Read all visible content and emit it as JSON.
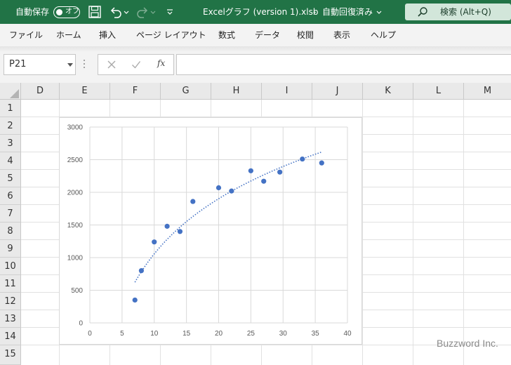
{
  "titlebar": {
    "autosave_label": "自動保存",
    "autosave_toggle": "オフ",
    "filename": "Excelグラフ (version 1).xlsb",
    "separator": "-",
    "status": "自動回復済み",
    "search_label": "検索 (Alt+Q)",
    "background_color": "#217346"
  },
  "menu": {
    "items": [
      "ファイル",
      "ホーム",
      "挿入",
      "ページ レイアウト",
      "数式",
      "データ",
      "校閲",
      "表示",
      "ヘルプ"
    ]
  },
  "formula_bar": {
    "name_box": "P21",
    "fx_label": "fx",
    "value": ""
  },
  "sheet": {
    "columns": [
      "D",
      "E",
      "F",
      "G",
      "H",
      "I",
      "J",
      "K",
      "L",
      "M"
    ],
    "rows": [
      "1",
      "2",
      "3",
      "4",
      "5",
      "6",
      "7",
      "8",
      "9",
      "10",
      "11",
      "12",
      "13",
      "14",
      "15"
    ]
  },
  "chart_data": {
    "type": "scatter",
    "title": "",
    "xlabel": "",
    "ylabel": "",
    "xlim": [
      0,
      40
    ],
    "ylim": [
      0,
      3000
    ],
    "x_ticks": [
      "0",
      "5",
      "10",
      "15",
      "20",
      "25",
      "30",
      "35",
      "40"
    ],
    "y_ticks": [
      "0",
      "500",
      "1000",
      "1500",
      "2000",
      "2500",
      "3000"
    ],
    "grid": true,
    "legend": "none",
    "series": [
      {
        "marker_color": "#4472c4",
        "x": [
          7,
          8,
          10,
          12,
          14,
          16,
          20,
          22,
          25,
          27,
          29.5,
          33,
          36
        ],
        "y": [
          350,
          800,
          1240,
          1480,
          1400,
          1860,
          2070,
          2020,
          2330,
          2170,
          2310,
          2510,
          2450
        ]
      }
    ],
    "trendline": {
      "type": "logarithmic",
      "style": "dotted",
      "color": "#4472c4",
      "x_range": [
        7,
        36
      ],
      "a": -1747,
      "b": 1218
    }
  },
  "watermark": "Buzzword Inc."
}
